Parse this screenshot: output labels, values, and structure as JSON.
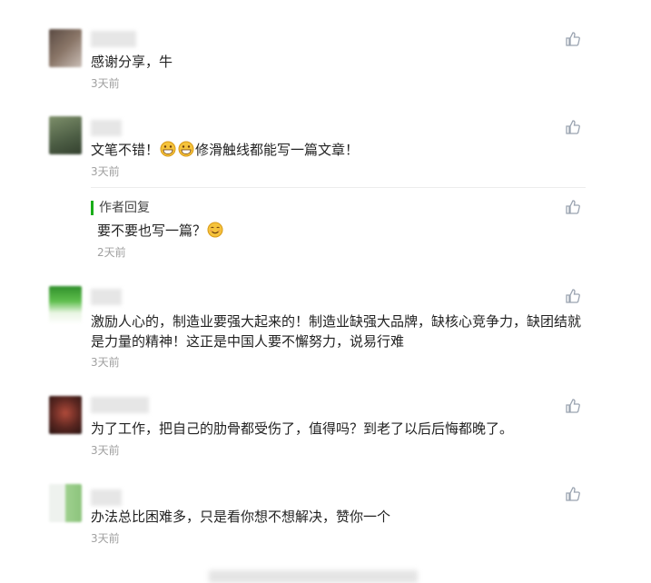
{
  "comments": [
    {
      "text": "感谢分享，牛",
      "time": "3天前"
    },
    {
      "text_before": "文笔不错！",
      "text_after": "修滑触线都能写一篇文章！",
      "time": "3天前",
      "reply": {
        "label": "作者回复",
        "text": "要不要也写一篇？",
        "time": "2天前"
      }
    },
    {
      "text": "激励人心的，制造业要强大起来的！制造业缺强大品牌，缺核心竞争力，缺团结就是力量的精神！这正是中国人要不懈努力，说易行难",
      "time": "3天前"
    },
    {
      "text": "为了工作，把自己的肋骨都受伤了，值得吗？到老了以后后悔都晚了。",
      "time": "3天前"
    },
    {
      "text": "办法总比困难多，只是看你想不想解决，赞你一个",
      "time": "3天前"
    }
  ],
  "icons": {
    "like": "thumbs-up-icon",
    "grin": "grinning-emoji-icon",
    "smile": "smiling-emoji-icon"
  },
  "colors": {
    "reply_bar": "#1aad19",
    "icon": "#9aa3b0",
    "time": "#a0a0a0"
  }
}
